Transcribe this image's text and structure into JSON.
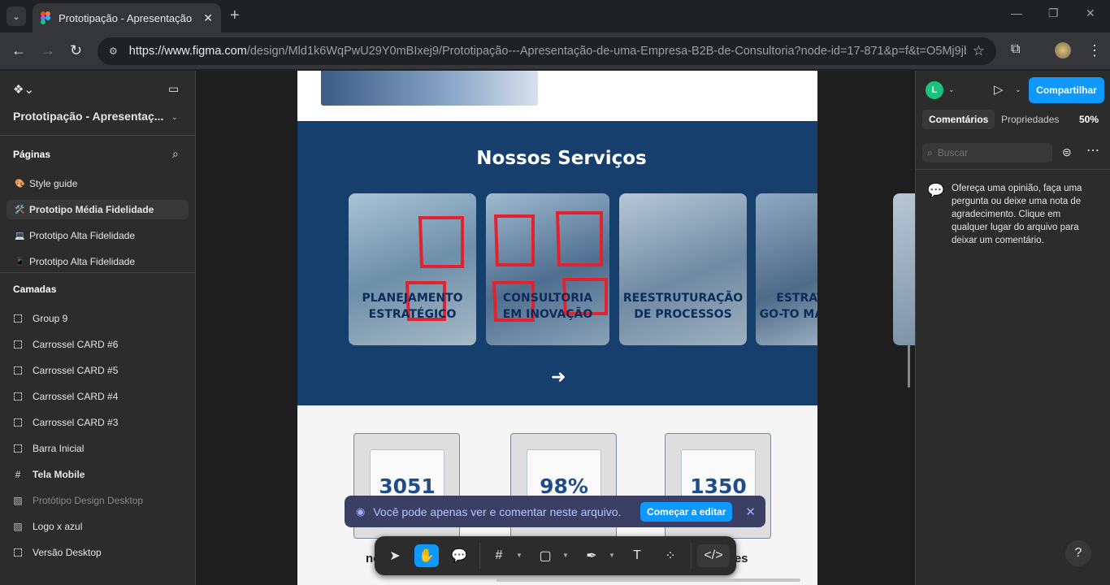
{
  "browser": {
    "tab_title": "Prototipação - Apresentação de",
    "url_host": "https://www.figma.com",
    "url_path": "/design/Mld1k6WqPwU29Y0mBIxej9/Prototipação---Apresentação-de-uma-Empresa-B2B-de-Consultoria?node-id=17-871&p=f&t=O5Mj9jb..."
  },
  "left_panel": {
    "file_name": "Prototipação - Apresentaç...",
    "pages_header": "Páginas",
    "pages": [
      {
        "icon": "🎨",
        "label": "Style guide"
      },
      {
        "icon": "🛠️",
        "label": "Prototipo Média Fidelidade"
      },
      {
        "icon": "💻",
        "label": "Prototipo Alta Fidelidade"
      },
      {
        "icon": "📱",
        "label": "Prototipo Alta Fidelidade"
      }
    ],
    "layers_header": "Camadas",
    "layers": [
      {
        "icon": "group",
        "label": "Group 9"
      },
      {
        "icon": "group",
        "label": "Carrossel CARD #6"
      },
      {
        "icon": "group",
        "label": "Carrossel CARD #5"
      },
      {
        "icon": "group",
        "label": "Carrossel CARD #4"
      },
      {
        "icon": "group",
        "label": "Carrossel CARD #3"
      },
      {
        "icon": "group",
        "label": "Barra Inicial"
      },
      {
        "icon": "frame",
        "label": "Tela Mobile"
      },
      {
        "icon": "image",
        "label": "Protótipo Design Desktop"
      },
      {
        "icon": "image",
        "label": "Logo x azul"
      },
      {
        "icon": "group",
        "label": "Versão Desktop"
      }
    ]
  },
  "canvas": {
    "services_title": "Nossos Serviços",
    "cards": [
      {
        "line1": "PLANEJAMENTO",
        "line2": "ESTRATÉGICO"
      },
      {
        "line1": "CONSULTORIA",
        "line2": "EM INOVAÇÃO"
      },
      {
        "line1": "REESTRUTURAÇÃO",
        "line2": "DE PROCESSOS"
      },
      {
        "line1": "ESTRATÉGIAS",
        "line2": "GO-TO MARKETING"
      }
    ],
    "stats": [
      "3051",
      "98%",
      "1350"
    ],
    "stat_label_left": "no",
    "stat_label_right": "res"
  },
  "banner": {
    "message": "Você pode apenas ver e comentar neste arquivo.",
    "button": "Começar a editar"
  },
  "right_panel": {
    "avatar_letter": "L",
    "share_label": "Compartilhar",
    "tab_comments": "Comentários",
    "tab_properties": "Propriedades",
    "zoom": "50%",
    "search_placeholder": "Buscar",
    "empty_comment_text": "Ofereça uma opinião, faça uma pergunta ou deixe uma nota de agradecimento. Clique em qualquer lugar do arquivo para deixar um comentário."
  },
  "colors": {
    "figma_blue": "#0d99ff",
    "services_bg": "#173f6e",
    "avatar_green": "#1bc47d"
  }
}
